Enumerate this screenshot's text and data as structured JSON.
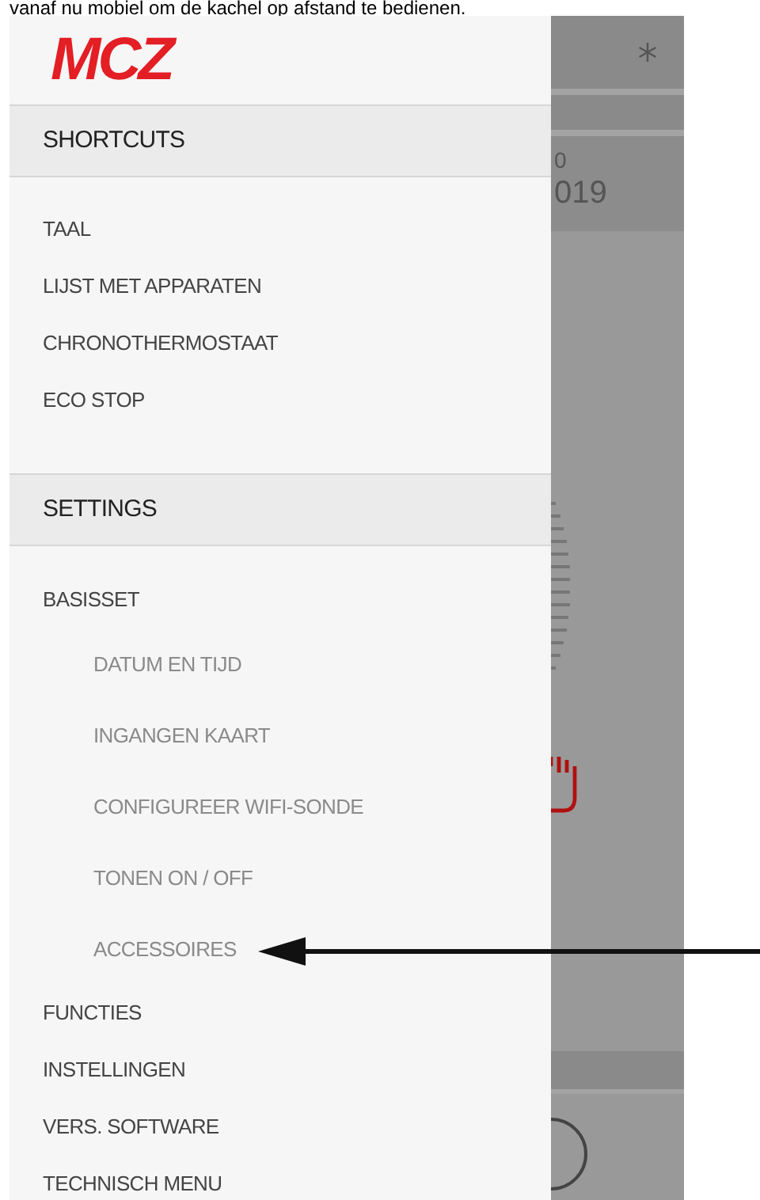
{
  "caption": "vanaf nu mobiel om de kachel op afstand te bedienen.",
  "logo": "MCZ",
  "sections": [
    {
      "header": "SHORTCUTS",
      "items": [
        {
          "label": "TAAL"
        },
        {
          "label": "LIJST MET APPARATEN"
        },
        {
          "label": "CHRONOTHERMOSTAAT"
        },
        {
          "label": "ECO STOP"
        }
      ]
    },
    {
      "header": "SETTINGS",
      "items": [
        {
          "label": "BASISSET",
          "children": [
            {
              "label": "DATUM EN TIJD"
            },
            {
              "label": "INGANGEN KAART"
            },
            {
              "label": "CONFIGUREER WIFI-SONDE"
            },
            {
              "label": "TONEN ON / OFF"
            },
            {
              "label": "ACCESSOIRES"
            }
          ]
        },
        {
          "label": "FUNCTIES"
        },
        {
          "label": "INSTELLINGEN"
        },
        {
          "label": "VERS. SOFTWARE"
        },
        {
          "label": "TECHNISCH MENU"
        }
      ]
    }
  ],
  "background_fragments": [
    "0",
    "019"
  ]
}
